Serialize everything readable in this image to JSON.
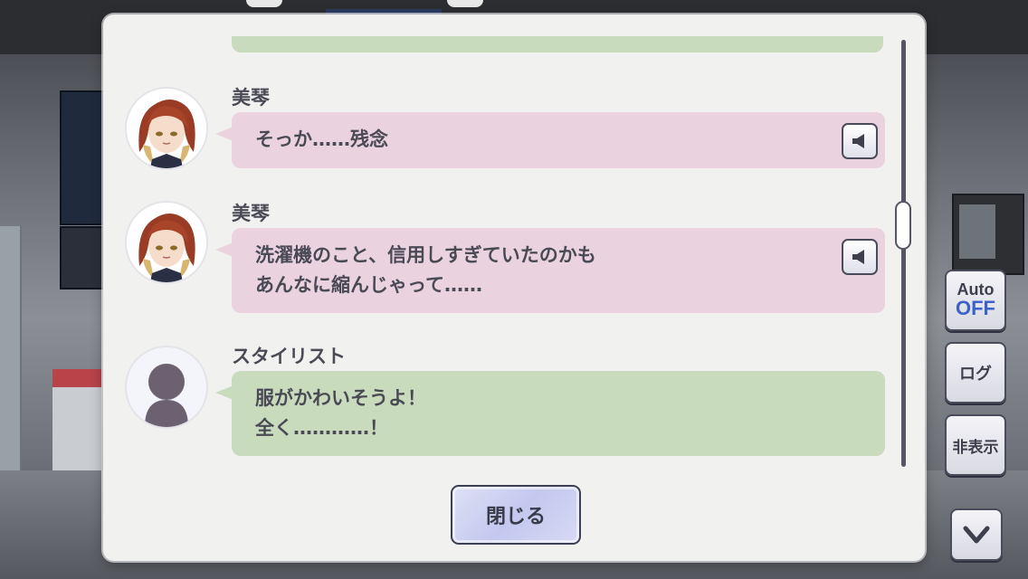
{
  "messages": [
    {
      "speaker": "美琴",
      "lines": [
        "そっか……残念"
      ],
      "color": "pink",
      "avatar": "mikoto-portrait",
      "voice": true
    },
    {
      "speaker": "美琴",
      "lines": [
        "洗濯機のこと、信用しすぎていたのかも",
        "あんなに縮んじゃって……"
      ],
      "color": "pink",
      "avatar": "mikoto-portrait",
      "voice": true
    },
    {
      "speaker": "スタイリスト",
      "lines": [
        "服がかわいそうよ！",
        "全く…………！"
      ],
      "color": "green",
      "avatar": "silhouette-icon",
      "voice": false
    }
  ],
  "close_label": "閉じる",
  "hud": {
    "auto_label": "Auto",
    "auto_state": "OFF",
    "log_label": "ログ",
    "hide_label": "非表示"
  },
  "colors": {
    "pink_bubble": "#ead3df",
    "green_bubble": "#c9dbbd",
    "panel": "#f1f1f0",
    "auto_off": "#3a62c9"
  }
}
